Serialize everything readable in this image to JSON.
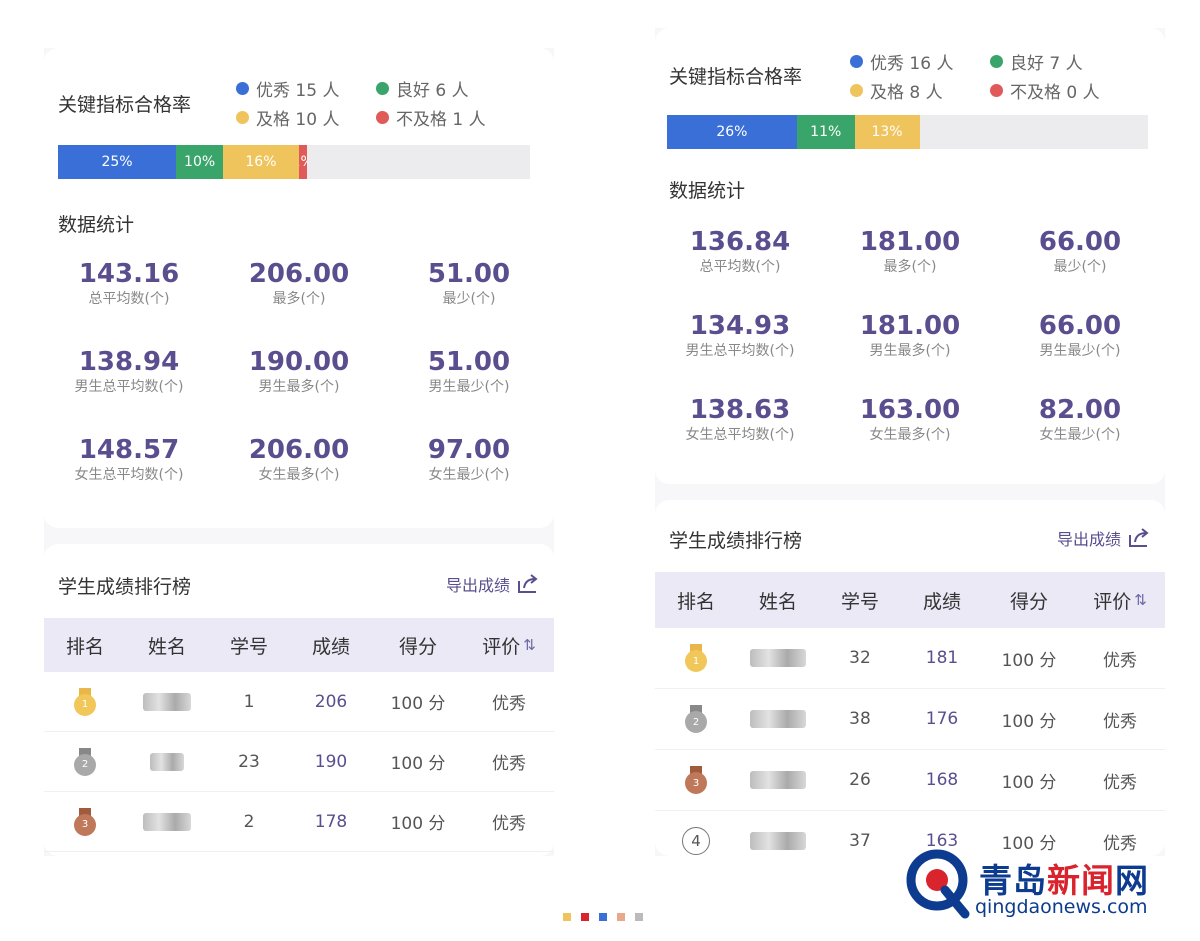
{
  "left": {
    "kpi": {
      "title": "关键指标合格率",
      "legend": [
        {
          "label": "优秀 15 人",
          "color": "#3a6fd8"
        },
        {
          "label": "良好 6 人",
          "color": "#3aa56a"
        },
        {
          "label": "及格 10 人",
          "color": "#efc45c"
        },
        {
          "label": "不及格 1 人",
          "color": "#e05a5a"
        }
      ],
      "bar": [
        {
          "label": "25%",
          "pct": 25,
          "color": "#3a6fd8"
        },
        {
          "label": "10%",
          "pct": 10,
          "color": "#3aa56a"
        },
        {
          "label": "16%",
          "pct": 16,
          "color": "#efc45c"
        },
        {
          "label": "1%",
          "pct": 1.7,
          "color": "#e05a5a"
        }
      ]
    },
    "stats": {
      "title": "数据统计",
      "items": [
        {
          "value": "143.16",
          "label": "总平均数(个)"
        },
        {
          "value": "206.00",
          "label": "最多(个)"
        },
        {
          "value": "51.00",
          "label": "最少(个)"
        },
        {
          "value": "138.94",
          "label": "男生总平均数(个)"
        },
        {
          "value": "190.00",
          "label": "男生最多(个)"
        },
        {
          "value": "51.00",
          "label": "男生最少(个)"
        },
        {
          "value": "148.57",
          "label": "女生总平均数(个)"
        },
        {
          "value": "206.00",
          "label": "女生最多(个)"
        },
        {
          "value": "97.00",
          "label": "女生最少(个)"
        }
      ]
    },
    "ranking": {
      "title": "学生成绩排行榜",
      "export_label": "导出成绩",
      "headers": [
        "排名",
        "姓名",
        "学号",
        "成绩",
        "得分",
        "评价"
      ],
      "rows": [
        {
          "medal": "gold",
          "id": "1",
          "score": "206",
          "points": "100 分",
          "eval": "优秀"
        },
        {
          "medal": "silver",
          "id": "23",
          "score": "190",
          "points": "100 分",
          "eval": "优秀"
        },
        {
          "medal": "bronze",
          "id": "2",
          "score": "178",
          "points": "100 分",
          "eval": "优秀"
        }
      ]
    }
  },
  "right": {
    "kpi": {
      "title": "关键指标合格率",
      "legend": [
        {
          "label": "优秀 16 人",
          "color": "#3a6fd8"
        },
        {
          "label": "良好 7 人",
          "color": "#3aa56a"
        },
        {
          "label": "及格 8 人",
          "color": "#efc45c"
        },
        {
          "label": "不及格 0 人",
          "color": "#e05a5a"
        }
      ],
      "bar": [
        {
          "label": "26%",
          "pct": 27,
          "color": "#3a6fd8"
        },
        {
          "label": "11%",
          "pct": 12,
          "color": "#3aa56a"
        },
        {
          "label": "13%",
          "pct": 13.5,
          "color": "#efc45c"
        }
      ]
    },
    "stats": {
      "title": "数据统计",
      "items": [
        {
          "value": "136.84",
          "label": "总平均数(个)"
        },
        {
          "value": "181.00",
          "label": "最多(个)"
        },
        {
          "value": "66.00",
          "label": "最少(个)"
        },
        {
          "value": "134.93",
          "label": "男生总平均数(个)"
        },
        {
          "value": "181.00",
          "label": "男生最多(个)"
        },
        {
          "value": "66.00",
          "label": "男生最少(个)"
        },
        {
          "value": "138.63",
          "label": "女生总平均数(个)"
        },
        {
          "value": "163.00",
          "label": "女生最多(个)"
        },
        {
          "value": "82.00",
          "label": "女生最少(个)"
        }
      ]
    },
    "ranking": {
      "title": "学生成绩排行榜",
      "export_label": "导出成绩",
      "headers": [
        "排名",
        "姓名",
        "学号",
        "成绩",
        "得分",
        "评价"
      ],
      "rows": [
        {
          "medal": "gold",
          "id": "32",
          "score": "181",
          "points": "100 分",
          "eval": "优秀"
        },
        {
          "medal": "silver",
          "id": "38",
          "score": "176",
          "points": "100 分",
          "eval": "优秀"
        },
        {
          "medal": "bronze",
          "id": "26",
          "score": "168",
          "points": "100 分",
          "eval": "优秀"
        },
        {
          "medal": "4",
          "id": "37",
          "score": "163",
          "points": "100 分",
          "eval": "优秀"
        }
      ]
    }
  },
  "watermark": {
    "brand_a": "青岛",
    "brand_b": "新闻",
    "brand_c": "网",
    "url": "qingdaonews.com"
  },
  "carousel_dots": [
    "#efc45c",
    "#d9232d",
    "#3a6fd8",
    "#e8a98a",
    "#bbbbbb"
  ]
}
